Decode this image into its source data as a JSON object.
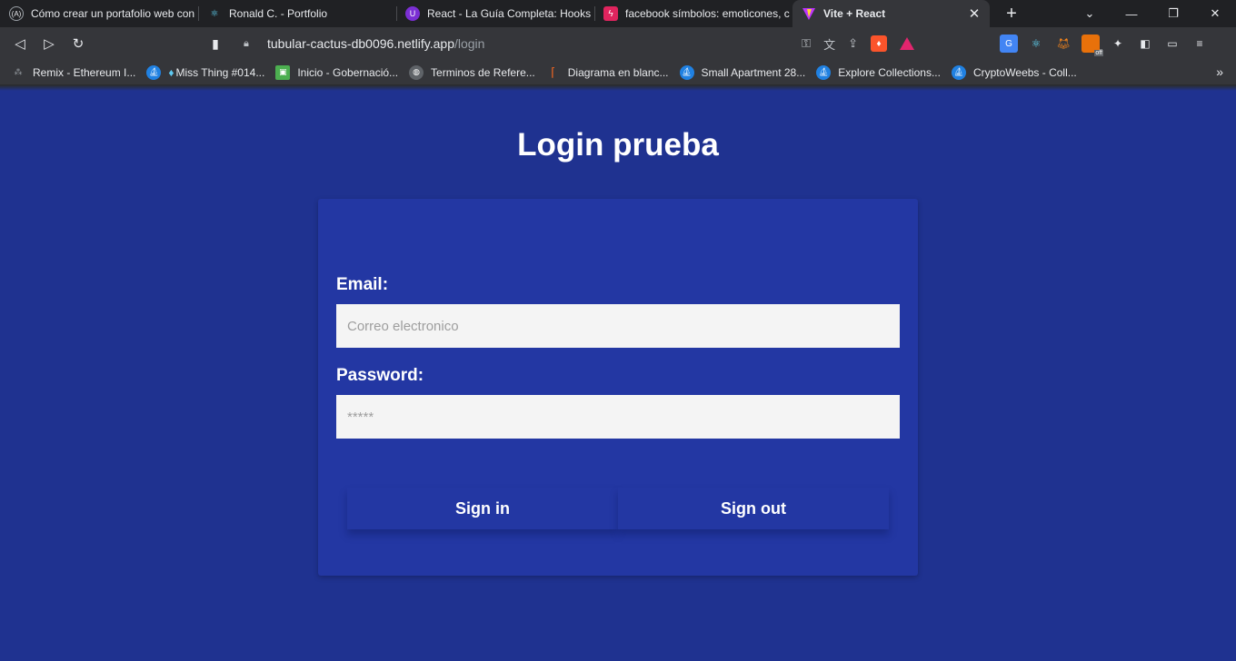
{
  "browser": {
    "tabs": [
      {
        "title": "Cómo crear un portafolio web con",
        "icon": "astro-icon",
        "active": false
      },
      {
        "title": "Ronald C. - Portfolio",
        "icon": "react-icon",
        "active": false
      },
      {
        "title": "React - La Guía Completa: Hooks C",
        "icon": "udemy-icon",
        "active": false
      },
      {
        "title": "facebook símbolos: emoticones, c",
        "icon": "symbols-icon",
        "active": false
      },
      {
        "title": "Vite + React",
        "icon": "vite-icon",
        "active": true
      }
    ],
    "url_host": "tubular-cactus-db0096.netlify.app",
    "url_path": "/login",
    "extension_badge": "off",
    "bookmarks": [
      {
        "label": "Remix - Ethereum I...",
        "icon": "remix-icon"
      },
      {
        "label": "Miss Thing #014...",
        "icon": "opensea-icon"
      },
      {
        "label": "Inicio - Gobernació...",
        "icon": "gov-icon"
      },
      {
        "label": "Terminos de Refere...",
        "icon": "globe-icon"
      },
      {
        "label": "Diagrama en blanc...",
        "icon": "diagram-icon"
      },
      {
        "label": "Small Apartment 28...",
        "icon": "opensea-icon"
      },
      {
        "label": "Explore Collections...",
        "icon": "opensea-icon"
      },
      {
        "label": "CryptoWeebs - Coll...",
        "icon": "opensea-icon"
      }
    ],
    "colors": {
      "chrome_bg": "#35363a",
      "tab_bar_bg": "#202124"
    }
  },
  "page": {
    "title": "Login prueba",
    "email_label": "Email:",
    "email_placeholder": "Correo electronico",
    "email_value": "",
    "password_label": "Password:",
    "password_placeholder": "*****",
    "password_value": "",
    "sign_in_label": "Sign in",
    "sign_out_label": "Sign out",
    "colors": {
      "background": "#1f3290",
      "card": "#2337a3",
      "text": "#ffffff",
      "input_bg": "#f4f4f4"
    }
  }
}
